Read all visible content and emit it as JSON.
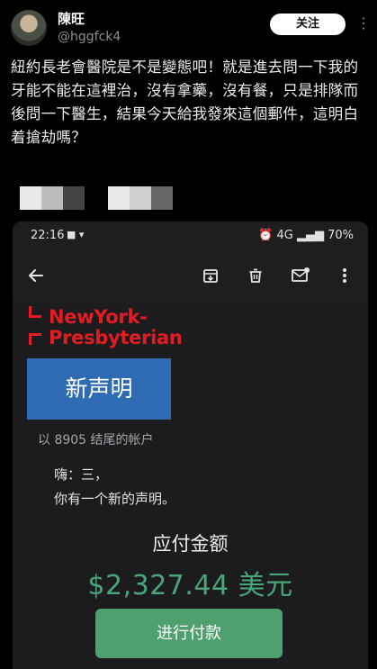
{
  "tweet": {
    "author_name": "陳旺",
    "author_handle": "@hggfck4",
    "follow_label": "关注",
    "more_glyph": "⋮",
    "text": "紐約長老會醫院是不是變態吧！就是進去問一下我的牙能不能在這裡治，沒有拿藥，沒有餐，只是排隊而後問一下醫生，結果今天給我發來這個郵件，這明白着搶劫嗎？"
  },
  "screenshot": {
    "status_bar": {
      "time": "22:16",
      "battery": "70%",
      "network": "4G"
    },
    "toolbar": {
      "back_icon": "arrow-back-icon",
      "archive_icon": "archive-icon",
      "delete_icon": "trash-icon",
      "mark_unread_icon": "mail-unread-icon",
      "more_icon": "more-vertical-icon"
    },
    "email": {
      "logo_line1": "NewYork-",
      "logo_line2": "Presbyterian",
      "statement_title": "新声明",
      "account_line": "以 8905 结尾的帐户",
      "greeting_line1": "嗨：三，",
      "greeting_line2": "你有一个新的声明。",
      "amount_label": "应付金额",
      "amount": "$2,327.44 美元",
      "pay_button": "进行付款"
    }
  },
  "colors": {
    "background": "#000000",
    "brand_red": "#e31c23",
    "statement_blue": "#2f6bb3",
    "amount_green": "#4aa678",
    "pay_button_green": "#4f9f6f"
  }
}
